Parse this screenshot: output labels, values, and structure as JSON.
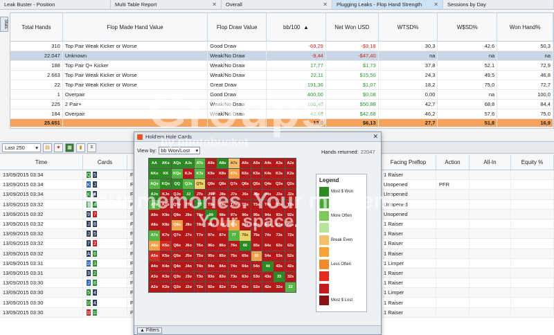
{
  "tabs": [
    {
      "label": "Leak Buster - Position",
      "close": "",
      "active": false
    },
    {
      "label": "Multi Table Report",
      "close": "✕",
      "active": false
    },
    {
      "label": "Overall",
      "close": "✕",
      "active": false
    },
    {
      "label": "Plugging Leaks - Flop Hand Strength",
      "close": "✕",
      "active": true
    },
    {
      "label": "Sessions by Day",
      "close": "",
      "active": false
    }
  ],
  "stats_tab_label": "Stats",
  "upper_table": {
    "headers": [
      "Total Hands",
      "Flop Made Hand Value",
      "Flop Draw Value",
      "bb/100",
      "Net Won USD",
      "WTSD%",
      "W$SD%",
      "Won Hand%"
    ],
    "sort_icon": "▲",
    "rows": [
      {
        "hands": "310",
        "made": "Top Pair Weak Kicker or Worse",
        "draw": "Good Draw",
        "bb": "-69,29",
        "won": "-$3,18",
        "wtsd": "30,3",
        "wsd": "42,6",
        "wonhand": "50,3",
        "sel": false
      },
      {
        "hands": "22.047",
        "made": "Unknown",
        "draw": "Weak/No Draw",
        "bb": "-9,44",
        "won": "-$47,40",
        "wtsd": "na",
        "wsd": "na",
        "wonhand": "na",
        "sel": true
      },
      {
        "hands": "188",
        "made": "Top Pair Q+ Kicker",
        "draw": "Weak/No Draw",
        "bb": "17,77",
        "won": "$1,73",
        "wtsd": "37,8",
        "wsd": "52,1",
        "wonhand": "72,9",
        "sel": false
      },
      {
        "hands": "2.663",
        "made": "Top Pair Weak Kicker or Worse",
        "draw": "Weak/No Draw",
        "bb": "22,11",
        "won": "$15,50",
        "wtsd": "24,3",
        "wsd": "49,5",
        "wonhand": "46,8",
        "sel": false
      },
      {
        "hands": "22",
        "made": "Top Pair Weak Kicker or Worse",
        "draw": "Great Draw",
        "bb": "191,36",
        "won": "$1,07",
        "wtsd": "18,2",
        "wsd": "75,0",
        "wonhand": "72,7",
        "sel": false
      },
      {
        "hands": "1",
        "made": "Overpair",
        "draw": "Good Draw",
        "bb": "400,00",
        "won": "$0,08",
        "wtsd": "0,00",
        "wsd": "na",
        "wonhand": "100,0",
        "sel": false
      },
      {
        "hands": "225",
        "made": "2 Pair+",
        "draw": "Weak/No Draw",
        "bb": "106,40",
        "won": "$50,88",
        "wtsd": "42,7",
        "wsd": "68,8",
        "wonhand": "84,4",
        "sel": false
      },
      {
        "hands": "184",
        "made": "Overpair",
        "draw": "Weak/No Draw",
        "bb": "42,68",
        "won": "$42,68",
        "wtsd": "46,2",
        "wsd": "57,6",
        "wonhand": "75,0",
        "sel": false
      }
    ],
    "total": {
      "hands": "25.651",
      "made": "",
      "draw": "",
      "bb": "13,0",
      "won": "$6,13",
      "wtsd": "27,7",
      "wsd": "51,8",
      "wonhand": "16,9"
    }
  },
  "toolbar": {
    "filter": "Last 250",
    "dropdown_icon": "▾"
  },
  "lower_table": {
    "headers": [
      "Time",
      "Cards",
      "",
      "Facing Preflop",
      "Action",
      "All-In",
      "Equity %"
    ],
    "rows": [
      {
        "time": "13/09/2015 03:34",
        "c1": "Q",
        "s1": "c",
        "c2": "5",
        "s2": "s",
        "desc": "F",
        "facing": "1 Raiser",
        "action": ""
      },
      {
        "time": "13/09/2015 03:34",
        "c1": "K",
        "s1": "d",
        "c2": "J",
        "s2": "s",
        "desc": "F",
        "facing": "Unopened",
        "action": "PFR"
      },
      {
        "time": "13/09/2015 03:34",
        "c1": "K",
        "s1": "c",
        "c2": "4",
        "s2": "s",
        "desc": "F",
        "facing": "Unopened",
        "action": ""
      },
      {
        "time": "13/09/2015 03:32",
        "c1": "5",
        "s1": "c",
        "c2": "4",
        "s2": "c",
        "desc": "F",
        "facing": "Unopened",
        "action": ""
      },
      {
        "time": "13/09/2015 03:32",
        "c1": "9",
        "s1": "s",
        "c2": "7",
        "s2": "h",
        "desc": "F",
        "facing": "Unopened",
        "action": ""
      },
      {
        "time": "13/09/2015 03:32",
        "c1": "J",
        "s1": "s",
        "c2": "8",
        "s2": "s",
        "desc": "F",
        "facing": "1 Raiser",
        "action": ""
      },
      {
        "time": "13/09/2015 03:32",
        "c1": "J",
        "s1": "s",
        "c2": "5",
        "s2": "s",
        "desc": "F",
        "facing": "1 Raiser",
        "action": ""
      },
      {
        "time": "13/09/2015 03:32",
        "c1": "7",
        "s1": "s",
        "c2": "2",
        "s2": "h",
        "desc": "F",
        "facing": "1 Raiser",
        "action": ""
      },
      {
        "time": "13/09/2015 03:32",
        "c1": "A",
        "s1": "s",
        "c2": "6",
        "s2": "c",
        "desc": "F",
        "facing": "1 Raiser",
        "action": ""
      },
      {
        "time": "13/09/2015 03:31",
        "c1": "10",
        "s1": "d",
        "c2": "3",
        "s2": "c",
        "desc": "F",
        "facing": "1 Limper",
        "action": ""
      },
      {
        "time": "13/09/2015 03:31",
        "c1": "3",
        "s1": "s",
        "c2": "2",
        "s2": "c",
        "desc": "F",
        "facing": "1 Raiser",
        "action": ""
      },
      {
        "time": "13/09/2015 03:30",
        "c1": "J",
        "s1": "d",
        "c2": "8",
        "s2": "c",
        "desc": "F",
        "facing": "1 Raiser",
        "action": ""
      },
      {
        "time": "13/09/2015 03:30",
        "c1": "5",
        "s1": "c",
        "c2": "4",
        "s2": "s",
        "desc": "F",
        "facing": "1 Limper",
        "action": ""
      },
      {
        "time": "13/09/2015 03:30",
        "c1": "10",
        "s1": "c",
        "c2": "4",
        "s2": "s",
        "desc": "F",
        "facing": "1 Raiser",
        "action": ""
      },
      {
        "time": "13/09/2015 03:30",
        "c1": "10",
        "s1": "h",
        "c2": "10",
        "s2": "c",
        "desc": "F",
        "facing": "1 Raiser",
        "action": ""
      }
    ]
  },
  "popup": {
    "title": "Hold'em Hole Cards",
    "close": "✕",
    "view_by_label": "View by:",
    "view_by_value": "bb Won/Lost",
    "hands_label": "Hands returned:",
    "hands_value": "22047",
    "legend_title": "Legend",
    "legend": [
      {
        "label": "Most $ Won",
        "color": "#2e8b24"
      },
      {
        "label": "",
        "color": "#45a832"
      },
      {
        "label": "More Often",
        "color": "#7cc95a"
      },
      {
        "label": "",
        "color": "#b7e39a"
      },
      {
        "label": "Break Even",
        "color": "#f4c06a"
      },
      {
        "label": "",
        "color": "#f7a33a"
      },
      {
        "label": "Less Often",
        "color": "#f08a2c"
      },
      {
        "label": "",
        "color": "#e42d1e"
      },
      {
        "label": "",
        "color": "#c21c1c"
      },
      {
        "label": "Most $ Lost",
        "color": "#8a1414"
      }
    ],
    "filters_label": "Filters",
    "ranks": [
      "A",
      "K",
      "Q",
      "J",
      "T",
      "9",
      "8",
      "7",
      "6",
      "5",
      "4",
      "3",
      "2"
    ],
    "matrix_colors": [
      [
        "g1",
        "g1",
        "g1",
        "g1",
        "g2",
        "r1",
        "g1",
        "o1",
        "r1",
        "r1",
        "r1",
        "r1",
        "r1"
      ],
      [
        "g1",
        "g1",
        "g2",
        "r1",
        "g2",
        "r1",
        "r1",
        "o2",
        "r1",
        "r1",
        "r1",
        "r1",
        "r1"
      ],
      [
        "g2",
        "g1",
        "g1",
        "g2",
        "o3",
        "r1",
        "r1",
        "r1",
        "r1",
        "r1",
        "r1",
        "r1",
        "r1"
      ],
      [
        "g1",
        "r1",
        "r1",
        "g1",
        "r1",
        "r1",
        "r1",
        "r1",
        "r1",
        "r1",
        "r1",
        "r1",
        "r1"
      ],
      [
        "g2",
        "r1",
        "r1",
        "r1",
        "g1",
        "r1",
        "r1",
        "r1",
        "r1",
        "r1",
        "r1",
        "r1",
        "r1"
      ],
      [
        "r1",
        "r1",
        "r1",
        "r1",
        "r1",
        "g1",
        "r1",
        "r1",
        "r1",
        "r1",
        "r1",
        "r1",
        "r1"
      ],
      [
        "r1",
        "r1",
        "o2",
        "r1",
        "r1",
        "r1",
        "r2",
        "o2",
        "r1",
        "r1",
        "r1",
        "r1",
        "r1"
      ],
      [
        "g2",
        "r1",
        "r1",
        "r1",
        "r1",
        "r1",
        "r1",
        "g2",
        "o3",
        "r1",
        "r1",
        "r1",
        "r1"
      ],
      [
        "o2",
        "r2",
        "r1",
        "r1",
        "r1",
        "r1",
        "r1",
        "r1",
        "g1",
        "r1",
        "r1",
        "r1",
        "r1"
      ],
      [
        "r2",
        "r1",
        "r1",
        "r1",
        "r1",
        "r1",
        "r1",
        "r1",
        "r1",
        "o2",
        "r1",
        "r1",
        "r1"
      ],
      [
        "r1",
        "r1",
        "r1",
        "r1",
        "r1",
        "r1",
        "r1",
        "r1",
        "r1",
        "r1",
        "g1",
        "r1",
        "r1"
      ],
      [
        "r1",
        "r1",
        "r1",
        "r1",
        "r1",
        "r1",
        "r1",
        "r1",
        "r1",
        "r1",
        "r1",
        "g1",
        "r1"
      ],
      [
        "r1",
        "r1",
        "r1",
        "r1",
        "r1",
        "r1",
        "r1",
        "r1",
        "r1",
        "r1",
        "r1",
        "r1",
        "g2"
      ]
    ],
    "palette": {
      "g1": "#2e8b24",
      "g2": "#57b544",
      "r1": "#b51818",
      "r2": "#d22a1e",
      "o1": "#f0c070",
      "o2": "#f3a04a",
      "o3": "#e9d46b"
    }
  },
  "watermark": {
    "logo": "Groups",
    "sub": "by photobucket",
    "tag1": "Your memories. Your moments.",
    "tag2": "Your space."
  }
}
